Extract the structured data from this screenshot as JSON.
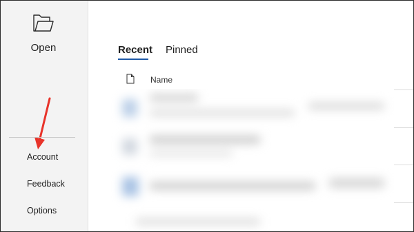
{
  "sidebar": {
    "open_label": "Open",
    "items": [
      {
        "label": "Account"
      },
      {
        "label": "Feedback"
      },
      {
        "label": "Options"
      }
    ]
  },
  "main": {
    "tabs": [
      {
        "label": "Recent",
        "active": true
      },
      {
        "label": "Pinned",
        "active": false
      }
    ],
    "list_header": {
      "name_label": "Name"
    }
  },
  "colors": {
    "accent": "#1f5aa8",
    "annotation_arrow": "#e8332a",
    "sidebar_bg": "#f3f3f3"
  }
}
